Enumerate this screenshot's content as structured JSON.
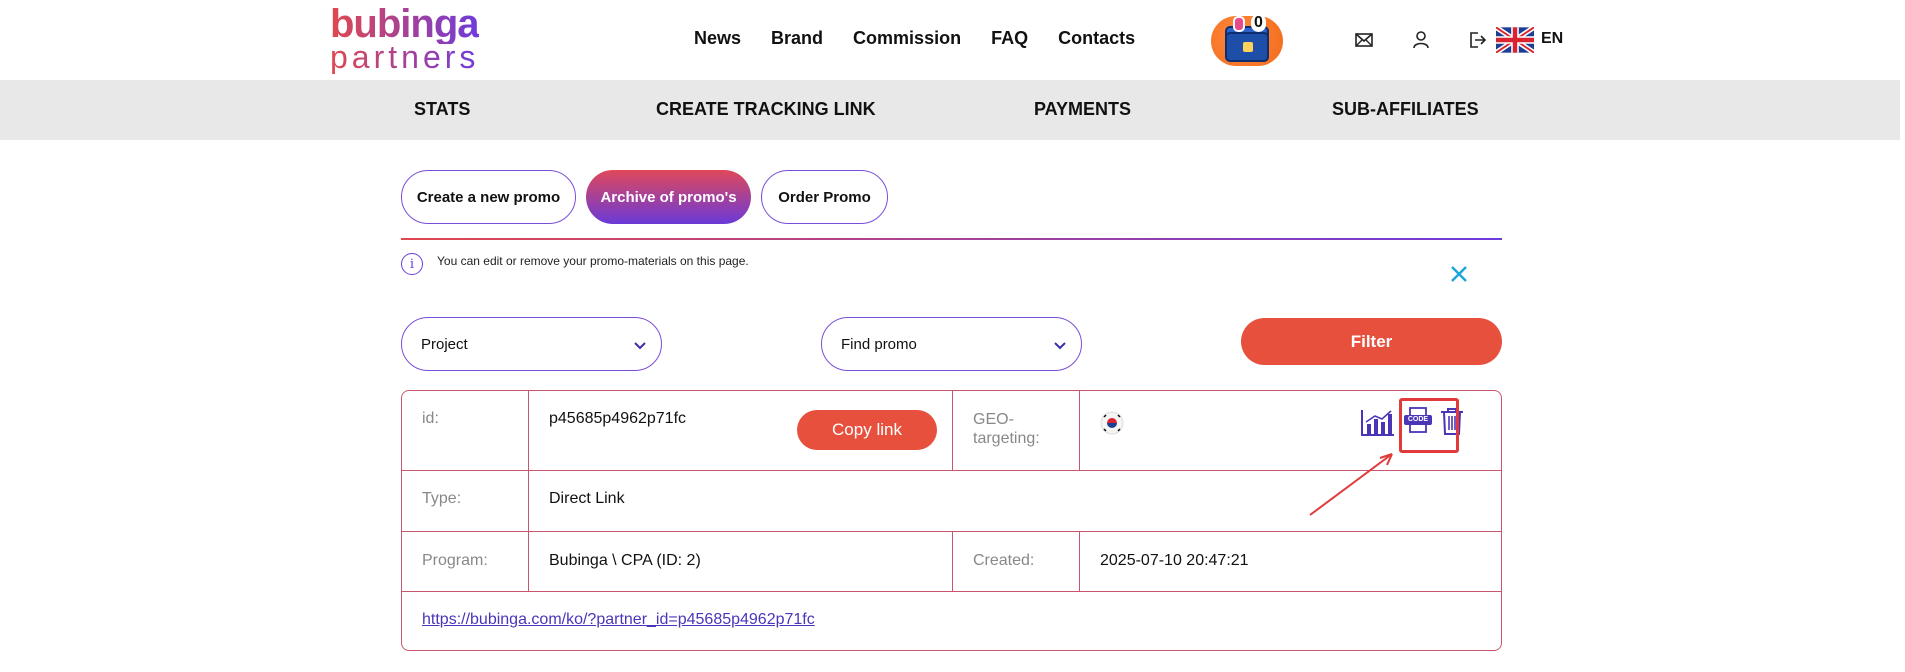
{
  "header": {
    "logo_top": "bubinga",
    "logo_bottom": "partners",
    "nav": [
      "News",
      "Brand",
      "Commission",
      "FAQ",
      "Contacts"
    ],
    "chest_count": "0",
    "language": "EN"
  },
  "subnav": [
    "STATS",
    "CREATE TRACKING LINK",
    "PAYMENTS",
    "SUB-AFFILIATES"
  ],
  "tabs": [
    "Create a new promo",
    "Archive of promo's",
    "Order Promo"
  ],
  "info": {
    "text": "You can edit or remove your promo-materials on this page."
  },
  "filters": {
    "project": "Project",
    "find_promo": "Find promo",
    "filter_label": "Filter"
  },
  "promo": {
    "id_label": "id:",
    "id_value": "p45685p4962p71fc",
    "copy_label": "Copy link",
    "geo_label": "GEO-targeting:",
    "geo_line1": "GEO-",
    "geo_line2": "targeting:",
    "type_label": "Type:",
    "type_value": "Direct Link",
    "program_label": "Program:",
    "program_value": "Bubinga \\ CPA (ID: 2)",
    "created_label": "Created:",
    "created_value": "2025-07-10 20:47:21",
    "url": "https://bubinga.com/ko/?partner_id=p45685p4962p71fc",
    "code_badge": "CODE"
  },
  "colors": {
    "accent_red": "#e8503e",
    "accent_purple": "#6e3bdc",
    "border": "#c8566f"
  },
  "icons": [
    "mail-icon",
    "user-icon",
    "logout-icon",
    "uk-flag-icon",
    "info-icon",
    "close-icon",
    "chevron-down-icon",
    "stats-icon",
    "code-icon",
    "trash-icon",
    "korea-flag-icon"
  ]
}
